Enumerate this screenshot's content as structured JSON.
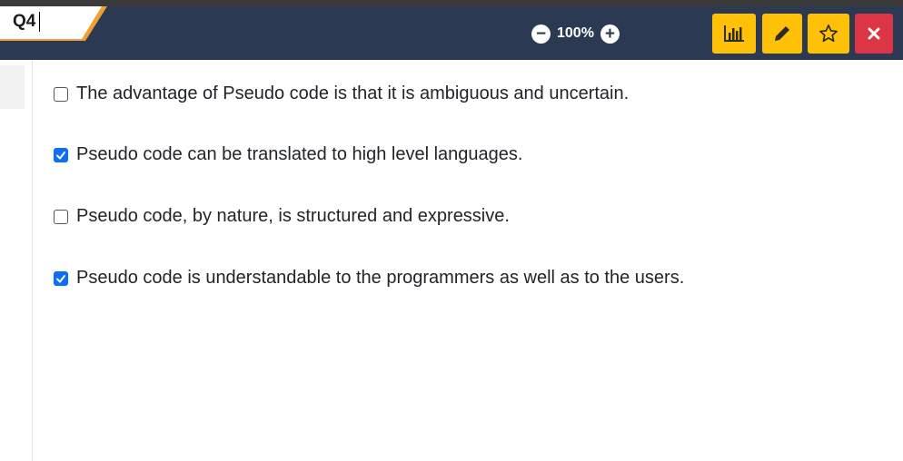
{
  "header": {
    "question_label": "Q4",
    "zoom_level": "100%",
    "zoom_out_symbol": "−",
    "zoom_in_symbol": "+",
    "buttons": [
      {
        "name": "stats",
        "icon": "bar-chart-icon",
        "color": "#ffc107"
      },
      {
        "name": "edit",
        "icon": "pencil-icon",
        "color": "#ffc107"
      },
      {
        "name": "favorite",
        "icon": "star-icon",
        "color": "#ffc107"
      },
      {
        "name": "close",
        "icon": "close-icon",
        "color": "#dc3545"
      }
    ],
    "colors": {
      "bar": "#2b3a52",
      "tab_accent": "#f0a030"
    }
  },
  "options": [
    {
      "text": "The advantage of Pseudo code is that it is ambiguous and uncertain.",
      "checked": false
    },
    {
      "text": "Pseudo code can be translated to high level languages.",
      "checked": true
    },
    {
      "text": "Pseudo code, by nature, is structured and expressive.",
      "checked": false
    },
    {
      "text": "Pseudo code is understandable to the programmers as well as to the users.",
      "checked": true
    }
  ],
  "checkbox_color": "#0d6efd"
}
